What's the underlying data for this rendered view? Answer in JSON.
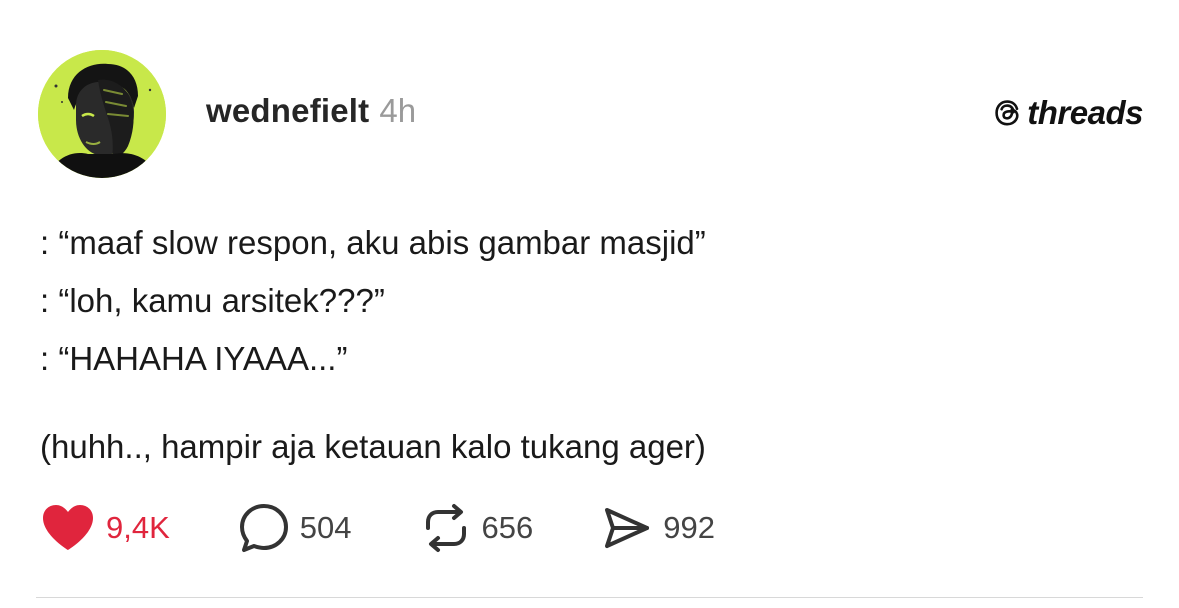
{
  "post": {
    "author": {
      "username": "wednefielt",
      "time": "4h",
      "avatar_icon": "profile-photo"
    },
    "brand": {
      "icon": "threads-logo-icon",
      "text": "threads"
    },
    "content": {
      "lines": [
        ": “maaf slow respon, aku abis gambar masjid”",
        ": “loh, kamu arsitek???”",
        ": “HAHAHA IYAAA...”",
        "(huhh.., hampir aja ketauan kalo tukang ager)"
      ]
    },
    "actions": {
      "like": {
        "icon": "heart-icon",
        "count": "9,4K",
        "active": true,
        "color": "#e0253d"
      },
      "comment": {
        "icon": "comment-icon",
        "count": "504"
      },
      "repost": {
        "icon": "repost-icon",
        "count": "656"
      },
      "share": {
        "icon": "send-icon",
        "count": "992"
      }
    }
  },
  "colors": {
    "background": "#ffffff",
    "text": "#1a1a1a",
    "muted": "#9a9a9a",
    "like": "#e0253d",
    "avatar_bg": "#c8e84a"
  }
}
